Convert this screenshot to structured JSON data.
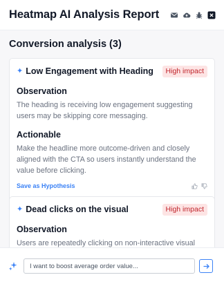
{
  "header": {
    "title": "Heatmap AI Analysis Report",
    "icons": [
      "mail-icon",
      "cloud-upload-icon",
      "bug-icon",
      "close-icon"
    ]
  },
  "section": {
    "title": "Conversion analysis (3)"
  },
  "cards": [
    {
      "title": "Low Engagement with Heading",
      "badge": "High impact",
      "observation_label": "Observation",
      "observation": "The heading is receiving low engagement suggesting users may be skipping core messaging.",
      "actionable_label": "Actionable",
      "actionable": "Make the headline more outcome-driven and closely aligned with the CTA so users instantly understand the value before clicking.",
      "save_label": "Save as Hypothesis"
    },
    {
      "title": "Dead clicks on the visual",
      "badge": "High impact",
      "observation_label": "Observation",
      "observation": "Users are repeatedly clicking on non-interactive visual"
    }
  ],
  "footer": {
    "placeholder": "I want to boost average order value..."
  },
  "colors": {
    "accent": "#3b82f6",
    "badge_bg": "#fde4e4",
    "badge_text": "#c0262d",
    "close": "#111827"
  }
}
